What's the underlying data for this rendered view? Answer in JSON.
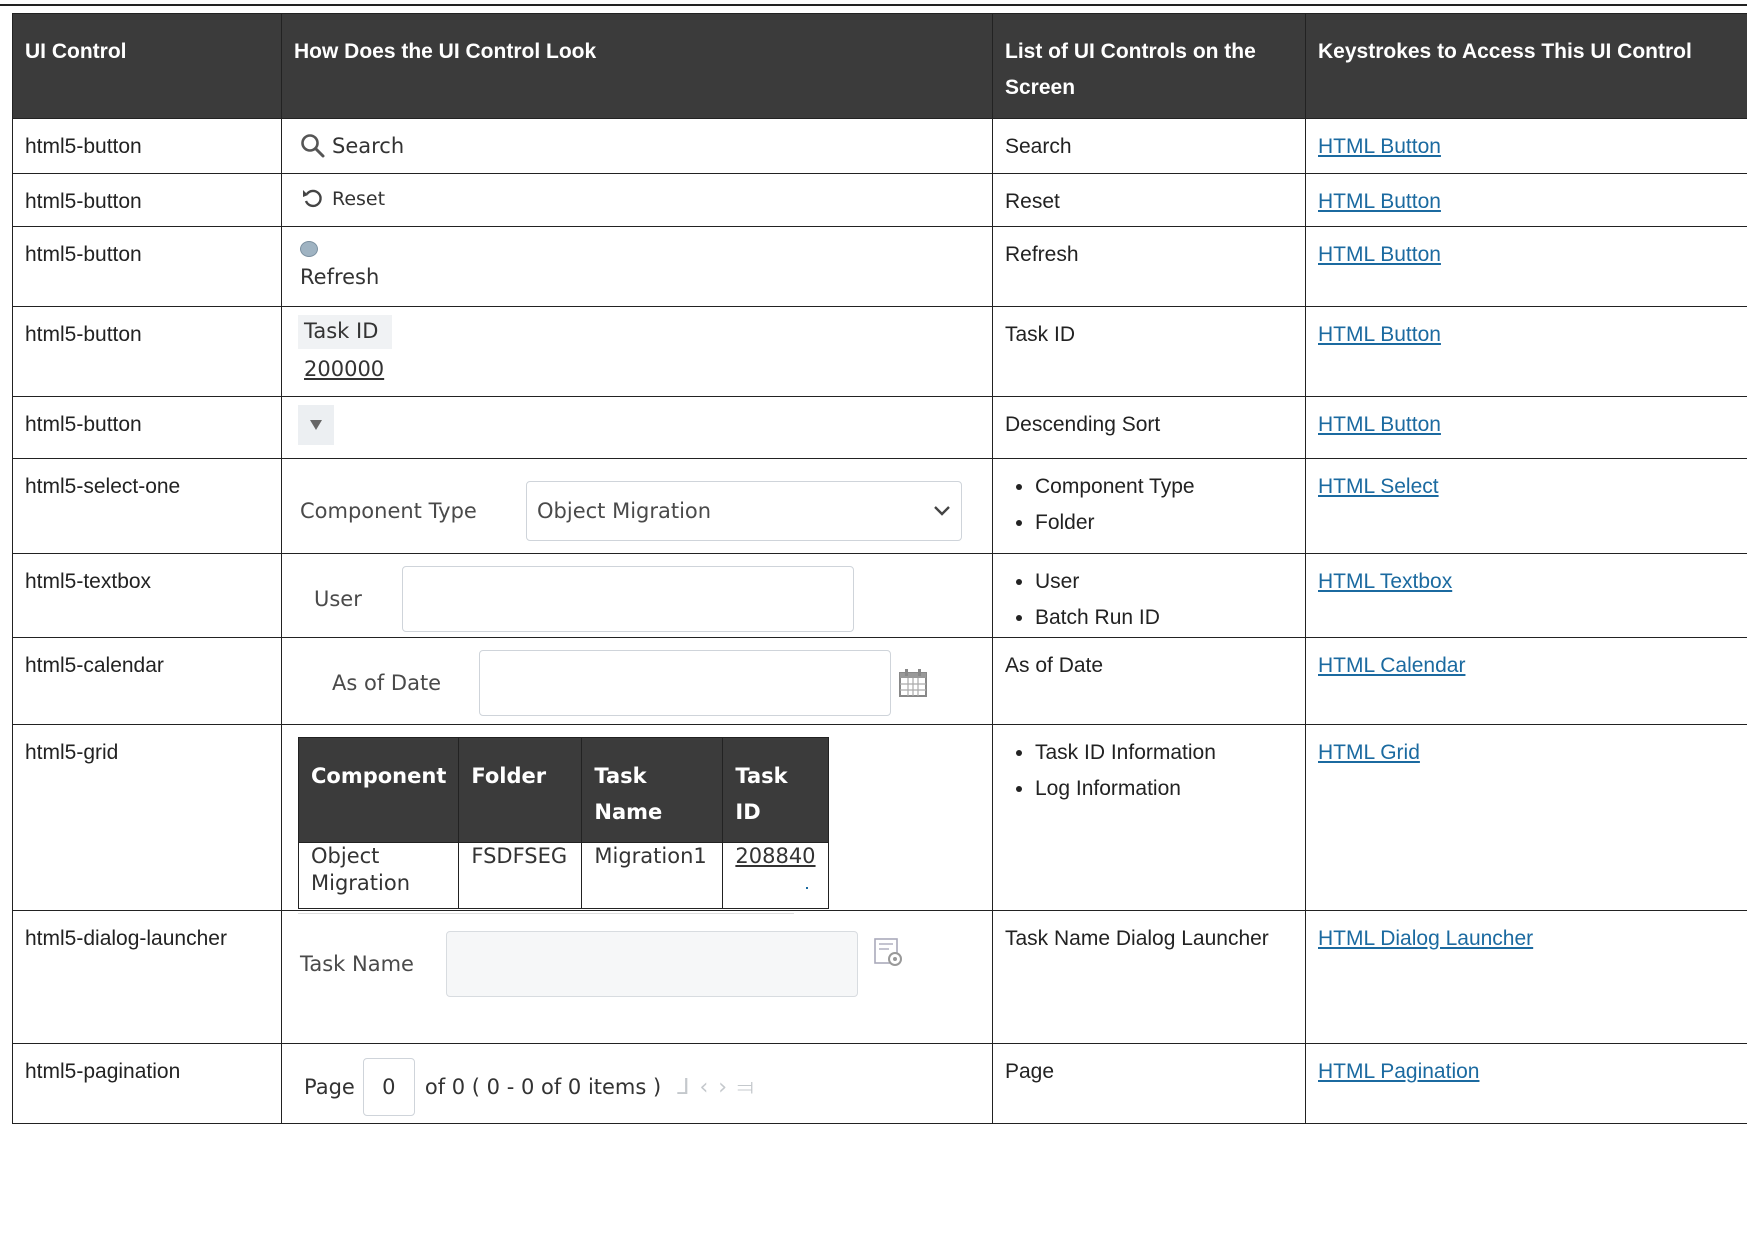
{
  "headers": {
    "col1": "UI Control",
    "col2": "How Does the UI Control Look",
    "col3": "List of UI Controls on the Screen",
    "col4": "Keystrokes to Access This UI Control"
  },
  "rows": [
    {
      "control": "html5-button",
      "screen_items": [
        "Search"
      ],
      "link": "HTML Button"
    },
    {
      "control": "html5-button",
      "screen_items": [
        "Reset"
      ],
      "link": "HTML Button"
    },
    {
      "control": "html5-button",
      "screen_items": [
        "Refresh"
      ],
      "link": "HTML Button"
    },
    {
      "control": "html5-button",
      "screen_items": [
        "Task ID"
      ],
      "link": "HTML Button"
    },
    {
      "control": "html5-button",
      "screen_items": [
        "Descending Sort"
      ],
      "link": "HTML Button"
    },
    {
      "control": "html5-select-one",
      "screen_items": [
        "Component Type",
        "Folder"
      ],
      "link": "HTML Select"
    },
    {
      "control": "html5-textbox",
      "screen_items": [
        "User",
        "Batch Run ID"
      ],
      "link": "HTML Textbox"
    },
    {
      "control": "html5-calendar",
      "screen_items": [
        "As of Date"
      ],
      "link": "HTML Calendar"
    },
    {
      "control": "html5-grid",
      "screen_items": [
        "Task ID Information",
        "Log Information"
      ],
      "link": "HTML Grid"
    },
    {
      "control": "html5-dialog-launcher",
      "screen_items": [
        "Task Name Dialog Launcher"
      ],
      "link": "HTML Dialog Launcher"
    },
    {
      "control": "html5-pagination",
      "screen_items": [
        "Page"
      ],
      "link": "HTML Pagination"
    }
  ],
  "samples": {
    "search_label": "Search",
    "reset_label": "Reset",
    "refresh_label": "Refresh",
    "taskid_header": "Task ID",
    "taskid_value": "200000",
    "select_label": "Component Type",
    "select_value": "Object Migration",
    "user_label": "User",
    "date_label": "As of Date",
    "grid": {
      "headers": [
        "Component",
        "Folder",
        "Task Name",
        "Task ID"
      ],
      "row": [
        "Object Migration",
        "FSDFSEG",
        "Migration1",
        "208840"
      ]
    },
    "taskname_label": "Task Name",
    "pagination": {
      "page_label": "Page",
      "page_value": "0",
      "summary": "of 0 ( 0 - 0 of 0 items )"
    }
  },
  "colors": {
    "header_bg": "#3b3b3b",
    "link": "#1b6aa0"
  },
  "icons": [
    "search-icon",
    "reset-icon",
    "refresh-icon",
    "sort-descending-icon",
    "chevron-down-icon",
    "calendar-icon",
    "dialog-launcher-icon",
    "first-page-icon",
    "prev-page-icon",
    "next-page-icon",
    "last-page-icon"
  ]
}
